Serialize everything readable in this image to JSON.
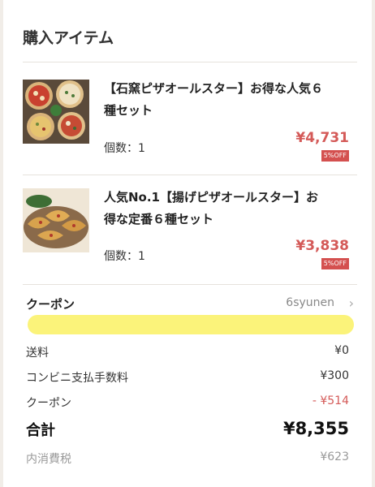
{
  "section_title": "購入アイテム",
  "items": [
    {
      "name_line1": "【石窯ピザオールスター】お得な人気６",
      "name_line2": "種セット",
      "qty_label": "個数：1",
      "price": "¥4,731",
      "discount_badge": "5%OFF"
    },
    {
      "name_line1": "人気No.1【揚げピザオールスター】お",
      "name_line2": "得な定番６種セット",
      "qty_label": "個数：1",
      "price": "¥3,838",
      "discount_badge": "5%OFF"
    }
  ],
  "coupon": {
    "label": "クーポン",
    "code": "6syunen",
    "chevron": "›"
  },
  "summary": {
    "shipping_label": "送料",
    "shipping_value": "¥0",
    "convenience_fee_label": "コンビニ支払手数料",
    "convenience_fee_value": "¥300",
    "coupon_label": "クーポン",
    "coupon_value": "- ¥514",
    "total_label": "合計",
    "total_value": "¥8,355",
    "tax_label": "内消費税",
    "tax_value": "¥623"
  },
  "colors": {
    "accent_red": "#d45a58",
    "badge_red": "#d4504f",
    "highlight_yellow": "#fbf37a"
  }
}
